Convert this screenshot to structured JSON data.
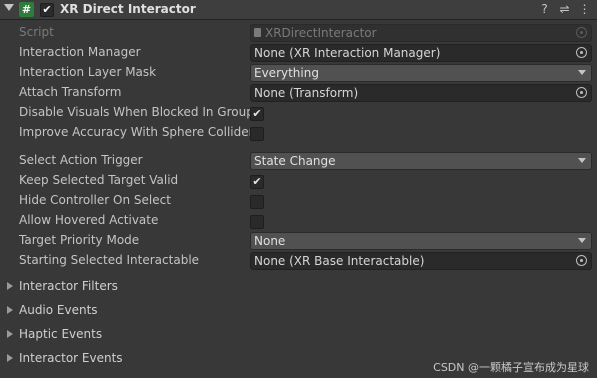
{
  "header": {
    "title": "XR Direct Interactor",
    "enabled": true,
    "script_icon_glyph": "#",
    "icons": [
      "help-icon",
      "presets-icon",
      "more-options-icon"
    ]
  },
  "fields": {
    "script": {
      "label": "Script",
      "value": "XRDirectInteractor"
    },
    "interaction_manager": {
      "label": "Interaction Manager",
      "value": "None (XR Interaction Manager)"
    },
    "interaction_layer_mask": {
      "label": "Interaction Layer Mask",
      "value": "Everything"
    },
    "attach_transform": {
      "label": "Attach Transform",
      "value": "None (Transform)"
    },
    "disable_visuals": {
      "label": "Disable Visuals When Blocked In Group",
      "checked": true
    },
    "improve_accuracy": {
      "label": "Improve Accuracy With Sphere Collider",
      "checked": false
    },
    "select_action_trigger": {
      "label": "Select Action Trigger",
      "value": "State Change"
    },
    "keep_selected_target_valid": {
      "label": "Keep Selected Target Valid",
      "checked": true
    },
    "hide_controller_on_select": {
      "label": "Hide Controller On Select",
      "checked": false
    },
    "allow_hovered_activate": {
      "label": "Allow Hovered Activate",
      "checked": false
    },
    "target_priority_mode": {
      "label": "Target Priority Mode",
      "value": "None"
    },
    "starting_selected_interactable": {
      "label": "Starting Selected Interactable",
      "value": "None (XR Base Interactable)"
    }
  },
  "foldouts": {
    "interactor_filters": "Interactor Filters",
    "audio_events": "Audio Events",
    "haptic_events": "Haptic Events",
    "interactor_events": "Interactor Events"
  },
  "watermark": "CSDN @一颗橘子宣布成为星球",
  "colors": {
    "background": "#383838",
    "header": "#3e3e3e",
    "field": "#2a2a2a",
    "dropdown": "#515151",
    "text": "#c4c4c4"
  }
}
